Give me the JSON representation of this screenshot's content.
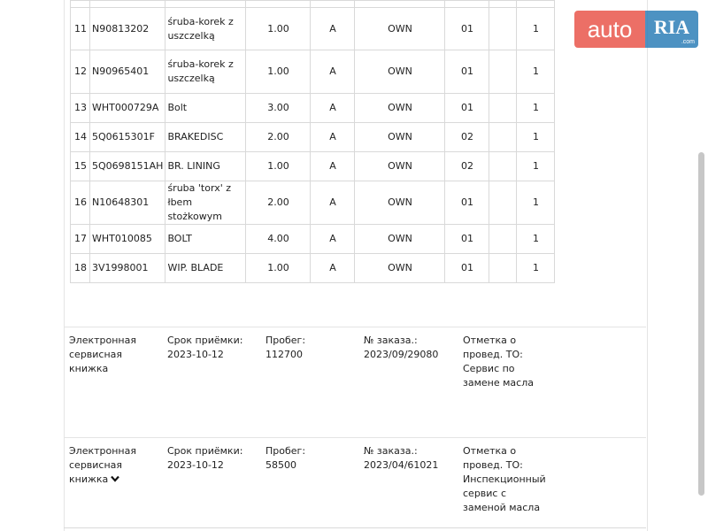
{
  "parts": [
    {
      "n": "11",
      "code": "N90813202",
      "name": "śruba-korek z uszczelką",
      "qty": "1.00",
      "type": "A",
      "src": "OWN",
      "grp": "01",
      "cnt": "1"
    },
    {
      "n": "12",
      "code": "N90965401",
      "name": "śruba-korek z uszczelką",
      "qty": "1.00",
      "type": "A",
      "src": "OWN",
      "grp": "01",
      "cnt": "1"
    },
    {
      "n": "13",
      "code": "WHT000729A",
      "name": "Bolt",
      "qty": "3.00",
      "type": "A",
      "src": "OWN",
      "grp": "01",
      "cnt": "1"
    },
    {
      "n": "14",
      "code": "5Q0615301F",
      "name": "BRAKEDISC",
      "qty": "2.00",
      "type": "A",
      "src": "OWN",
      "grp": "02",
      "cnt": "1"
    },
    {
      "n": "15",
      "code": "5Q0698151AH",
      "name": "BR. LINING",
      "qty": "1.00",
      "type": "A",
      "src": "OWN",
      "grp": "02",
      "cnt": "1"
    },
    {
      "n": "16",
      "code": "N10648301",
      "name": "śruba 'torx' z łbem stożkowym",
      "qty": "2.00",
      "type": "A",
      "src": "OWN",
      "grp": "01",
      "cnt": "1"
    },
    {
      "n": "17",
      "code": "WHT010085",
      "name": "BOLT",
      "qty": "4.00",
      "type": "A",
      "src": "OWN",
      "grp": "01",
      "cnt": "1"
    },
    {
      "n": "18",
      "code": "3V1998001",
      "name": "WIP. BLADE",
      "qty": "1.00",
      "type": "A",
      "src": "OWN",
      "grp": "01",
      "cnt": "1"
    }
  ],
  "records": [
    {
      "book": "Электронная сервисная книжка",
      "date_label": "Срок приёмки:",
      "date": "2023-10-12",
      "mileage_label": "Пробег:",
      "mileage": "112700",
      "order_label": "№ заказа.:",
      "order": "2023/09/29080",
      "mark_label": "Отметка о провед. ТО:",
      "mark": "Сервис по замене масла"
    },
    {
      "book": "Электронная сервисная книжка",
      "date_label": "Срок приёмки:",
      "date": "2023-10-12",
      "mileage_label": "Пробег:",
      "mileage": "58500",
      "order_label": "№ заказа.:",
      "order": "2023/04/61021",
      "mark_label": "Отметка о провед. ТО:",
      "mark": "Инспекционный сервис с заменой масла"
    }
  ],
  "icons": {
    "expand": "chevron-down-icon"
  },
  "logo": {
    "auto": "auto",
    "ria": "RIA",
    "domain": ".com",
    "auto_color": "#e9574c",
    "ria_color": "#2f7fb8"
  }
}
